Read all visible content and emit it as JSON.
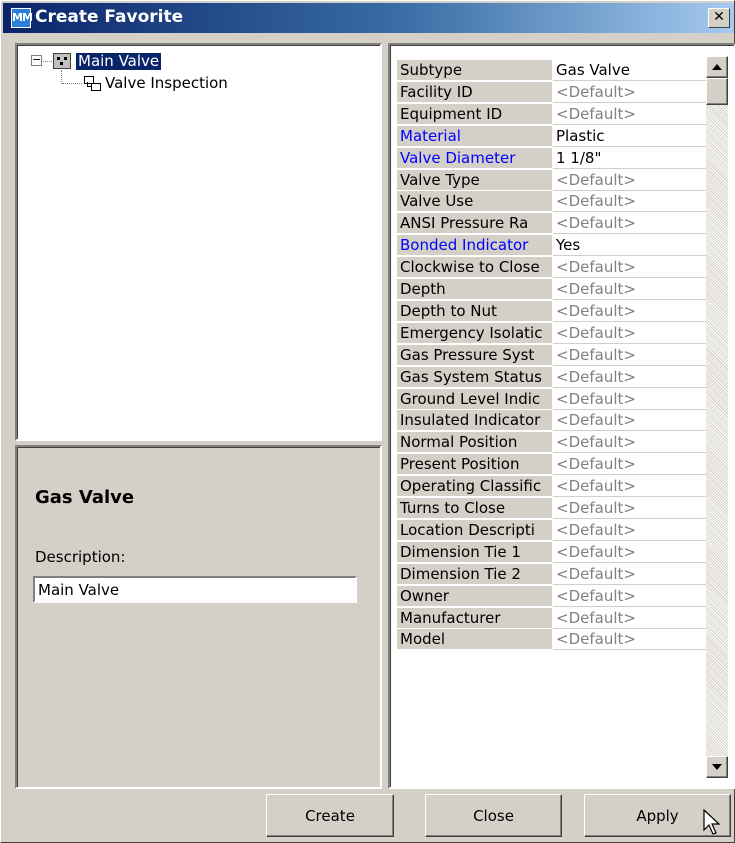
{
  "window": {
    "title": "Create Favorite",
    "icon_text": "MM",
    "close_glyph": "✕"
  },
  "tree": {
    "expand_glyph": "−",
    "root": {
      "label": "Main Valve",
      "icon": "valve-feature-icon"
    },
    "children": [
      {
        "label": "Valve Inspection",
        "icon": "related-object-icon"
      }
    ]
  },
  "description_panel": {
    "heading": "Gas Valve",
    "description_label": "Description:",
    "description_value": "Main Valve"
  },
  "properties": [
    {
      "name": "Subtype",
      "value": "Gas Valve",
      "required": false,
      "is_default": false
    },
    {
      "name": "Facility ID",
      "value": "<Default>",
      "required": false,
      "is_default": true
    },
    {
      "name": "Equipment ID",
      "value": "<Default>",
      "required": false,
      "is_default": true
    },
    {
      "name": "Material",
      "value": "Plastic",
      "required": true,
      "is_default": false
    },
    {
      "name": "Valve Diameter",
      "value": "1 1/8\"",
      "required": true,
      "is_default": false
    },
    {
      "name": "Valve Type",
      "value": "<Default>",
      "required": false,
      "is_default": true
    },
    {
      "name": "Valve Use",
      "value": "<Default>",
      "required": false,
      "is_default": true
    },
    {
      "name": "ANSI Pressure Ra",
      "value": "<Default>",
      "required": false,
      "is_default": true
    },
    {
      "name": "Bonded Indicator",
      "value": "Yes",
      "required": true,
      "is_default": false
    },
    {
      "name": "Clockwise to Close",
      "value": "<Default>",
      "required": false,
      "is_default": true
    },
    {
      "name": "Depth",
      "value": "<Default>",
      "required": false,
      "is_default": true
    },
    {
      "name": "Depth to Nut",
      "value": "<Default>",
      "required": false,
      "is_default": true
    },
    {
      "name": "Emergency Isolatic",
      "value": "<Default>",
      "required": false,
      "is_default": true
    },
    {
      "name": "Gas Pressure Syst",
      "value": "<Default>",
      "required": false,
      "is_default": true
    },
    {
      "name": "Gas System Status",
      "value": "<Default>",
      "required": false,
      "is_default": true
    },
    {
      "name": "Ground Level Indic",
      "value": "<Default>",
      "required": false,
      "is_default": true
    },
    {
      "name": "Insulated Indicator",
      "value": "<Default>",
      "required": false,
      "is_default": true
    },
    {
      "name": "Normal Position",
      "value": "<Default>",
      "required": false,
      "is_default": true
    },
    {
      "name": "Present Position",
      "value": "<Default>",
      "required": false,
      "is_default": true
    },
    {
      "name": "Operating Classific",
      "value": "<Default>",
      "required": false,
      "is_default": true
    },
    {
      "name": "Turns to Close",
      "value": "<Default>",
      "required": false,
      "is_default": true
    },
    {
      "name": "Location Descripti",
      "value": "<Default>",
      "required": false,
      "is_default": true
    },
    {
      "name": "Dimension Tie 1",
      "value": "<Default>",
      "required": false,
      "is_default": true
    },
    {
      "name": "Dimension Tie 2",
      "value": "<Default>",
      "required": false,
      "is_default": true
    },
    {
      "name": "Owner",
      "value": "<Default>",
      "required": false,
      "is_default": true
    },
    {
      "name": "Manufacturer",
      "value": "<Default>",
      "required": false,
      "is_default": true
    },
    {
      "name": "Model",
      "value": "<Default>",
      "required": false,
      "is_default": true
    }
  ],
  "colors": {
    "required_field": "#0000ff",
    "default_value": "#808080",
    "selection": "#0a246a"
  },
  "buttons": {
    "create": "Create",
    "close": "Close",
    "apply": "Apply"
  }
}
